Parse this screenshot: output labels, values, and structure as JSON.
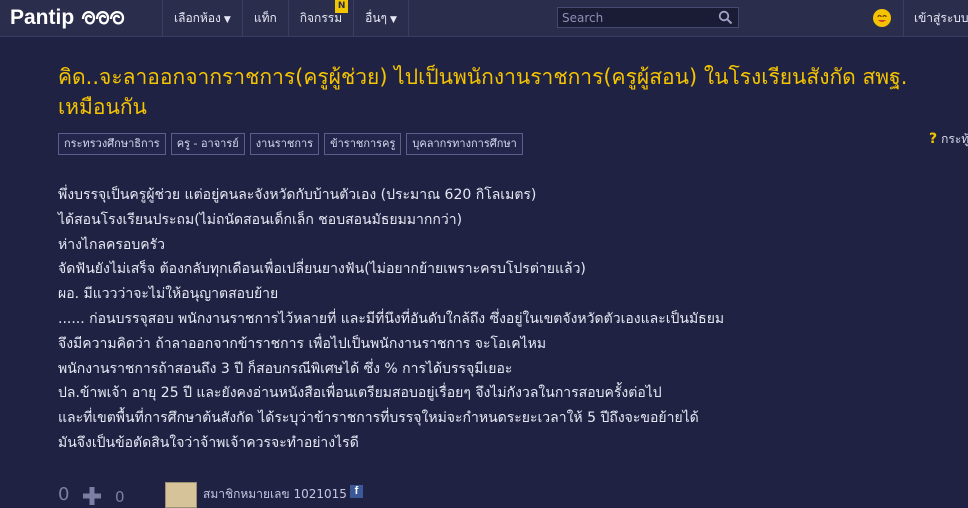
{
  "header": {
    "logo_text": "Pantip",
    "nav": [
      {
        "label": "เลือกห้อง",
        "caret": "▼"
      },
      {
        "label": "แท็ก"
      },
      {
        "label": "กิจกรรม",
        "badge": "N"
      },
      {
        "label": "อื่นๆ",
        "caret": "▼"
      }
    ],
    "search_placeholder": "Search",
    "login_label": "เข้าสู่ระบบ"
  },
  "topic": {
    "title": "คิด..จะลาออกจากราชการ(ครูผู้ช่วย) ไปเป็นพนักงานราชการ(ครูผู้สอน) ในโรงเรียนสังกัด สพฐ. เหมือนกัน",
    "tags": [
      "กระทรวงศึกษาธิการ",
      "ครู - อาจารย์",
      "งานราชการ",
      "ข้าราชการครู",
      "บุคลากรทางการศึกษา"
    ],
    "help_label": "กระทู้",
    "body_lines": [
      "พึ่งบรรจุเป็นครูผู้ช่วย แต่อยู่คนละจังหวัดกับบ้านตัวเอง (ประมาณ 620 กิโลเมตร)",
      "ได้สอนโรงเรียนประถม(ไม่ถนัดสอนเด็กเล็ก ชอบสอนมัธยมมากกว่า)",
      "ห่างไกลครอบครัว",
      "จัดฟันยังไม่เสร็จ ต้องกลับทุกเดือนเพื่อเปลี่ยนยางฟัน(ไม่อยากย้ายเพราะครบโปรต่ายแล้ว)",
      "ผอ. มีแววว่าจะไม่ให้อนุญาตสอบย้าย",
      "...... ก่อนบรรจุสอบ พนักงานราชการไว้หลายที่ และมีที่นึงที่อันดับใกล้ถึง ซึ่งอยู่ในเขตจังหวัดตัวเองและเป็นมัธยม",
      "จึงมีความคิดว่า ถ้าลาออกจากข้าราชการ เพื่อไปเป็นพนักงานราชการ จะโอเคไหม",
      "พนักงานราชการถ้าสอนถึง 3 ปี ก็สอบกรณีพิเศษได้ ซึ่ง % การได้บรรจุมีเยอะ",
      "ปล.ข้าพเจ้า อายุ 25 ปี และยังคงอ่านหนังสือเพื่อนเตรียมสอบอยู่เรื่อยๆ จึงไม่กังวลในการสอบครั้งต่อไป",
      "และที่เขตพื้นที่การศึกษาต้นสังกัด ได้ระบุว่าข้าราชการที่บรรจุใหม่จะกำหนดระยะเวลาให้ 5 ปีถึงจะขอย้ายได้",
      "มันจึงเป็นข้อตัดสินใจว่าจ้าพเจ้าควรจะทำอย่างไรดี"
    ]
  },
  "footer": {
    "vote_count": "0",
    "emotion_count": "0",
    "member_label": "สมาชิกหมายเลข 1021015",
    "fb_label": "f"
  },
  "colors": {
    "background": "#1f2242",
    "topbar": "#2a2d4c",
    "title": "#f5c400",
    "text": "#e7e8f4"
  }
}
